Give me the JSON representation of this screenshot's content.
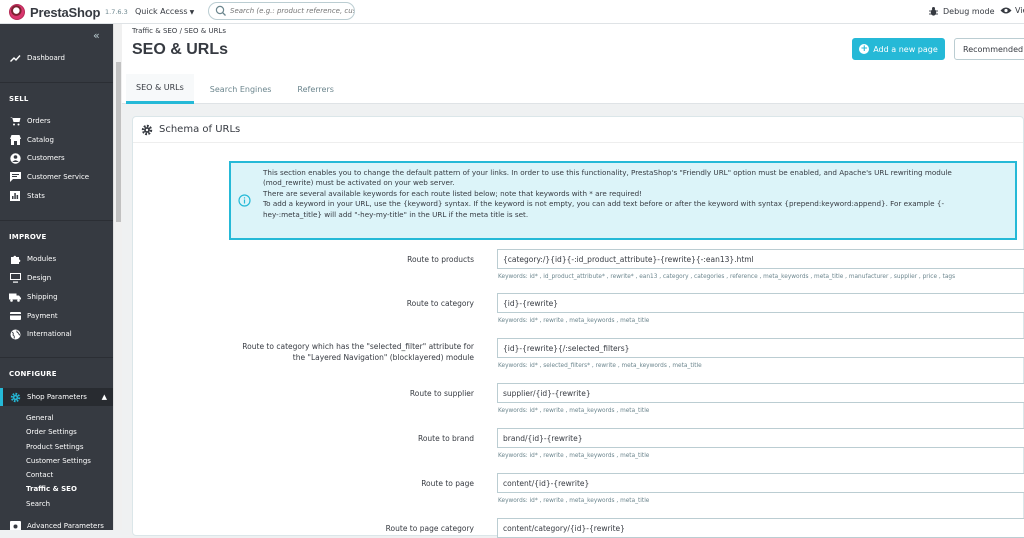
{
  "topbar": {
    "logo_text": "PrestaShop",
    "version": "1.7.6.3",
    "quick_access": "Quick Access",
    "search_placeholder": "Search (e.g.: product reference, customer name...)",
    "debug_mode": "Debug mode",
    "view_label": "View my shop"
  },
  "sidebar": {
    "dashboard": "Dashboard",
    "sell_title": "SELL",
    "sell_items": [
      "Orders",
      "Catalog",
      "Customers",
      "Customer Service",
      "Stats"
    ],
    "improve_title": "IMPROVE",
    "improve_items": [
      "Modules",
      "Design",
      "Shipping",
      "Payment",
      "International"
    ],
    "configure_title": "CONFIGURE",
    "shop_parameters": "Shop Parameters",
    "sub_items": [
      "General",
      "Order Settings",
      "Product Settings",
      "Customer Settings",
      "Contact",
      "Traffic & SEO",
      "Search"
    ],
    "advanced_parameters": "Advanced Parameters",
    "accent": "#25b9d7"
  },
  "header": {
    "breadcrumb_1": "Traffic & SEO",
    "breadcrumb_sep": "/",
    "breadcrumb_2": "SEO & URLs",
    "title": "SEO & URLs",
    "add_page": "Add a new page",
    "recommended": "Recommended Modules"
  },
  "tabs": [
    "SEO & URLs",
    "Search Engines",
    "Referrers"
  ],
  "panel": {
    "heading": "Schema of URLs",
    "alert_lines": [
      "This section enables you to change the default pattern of your links. In order to use this functionality, PrestaShop's \"Friendly URL\" option must be enabled, and Apache's URL rewriting module",
      "(mod_rewrite) must be activated on your web server.",
      "There are several available keywords for each route listed below; note that keywords with * are required!",
      "To add a keyword in your URL, use the {keyword} syntax. If the keyword is not empty, you can add text before or after the keyword with syntax {prepend:keyword:append}. For example {-",
      "hey-:meta_title} will add \"-hey-my-title\" in the URL if the meta title is set."
    ]
  },
  "routes": [
    {
      "label": "Route to products",
      "value": "{category:/}{id}{-:id_product_attribute}-{rewrite}{-:ean13}.html",
      "help": "Keywords: id* , id_product_attribute* , rewrite* , ean13 , category , categories , reference , meta_keywords , meta_title , manufacturer , supplier , price , tags"
    },
    {
      "label": "Route to category",
      "value": "{id}-{rewrite}",
      "help": "Keywords: id* , rewrite , meta_keywords , meta_title"
    },
    {
      "label_line1": "Route to category which has the \"selected_filter\" attribute for",
      "label_line2": "the \"Layered Navigation\" (blocklayered) module",
      "value": "{id}-{rewrite}{/:selected_filters}",
      "help": "Keywords: id* , selected_filters* , rewrite , meta_keywords , meta_title"
    },
    {
      "label": "Route to supplier",
      "value": "supplier/{id}-{rewrite}",
      "help": "Keywords: id* , rewrite , meta_keywords , meta_title"
    },
    {
      "label": "Route to brand",
      "value": "brand/{id}-{rewrite}",
      "help": "Keywords: id* , rewrite , meta_keywords , meta_title"
    },
    {
      "label": "Route to page",
      "value": "content/{id}-{rewrite}",
      "help": "Keywords: id* , rewrite , meta_keywords , meta_title"
    },
    {
      "label": "Route to page category",
      "value": "content/category/{id}-{rewrite}"
    }
  ]
}
